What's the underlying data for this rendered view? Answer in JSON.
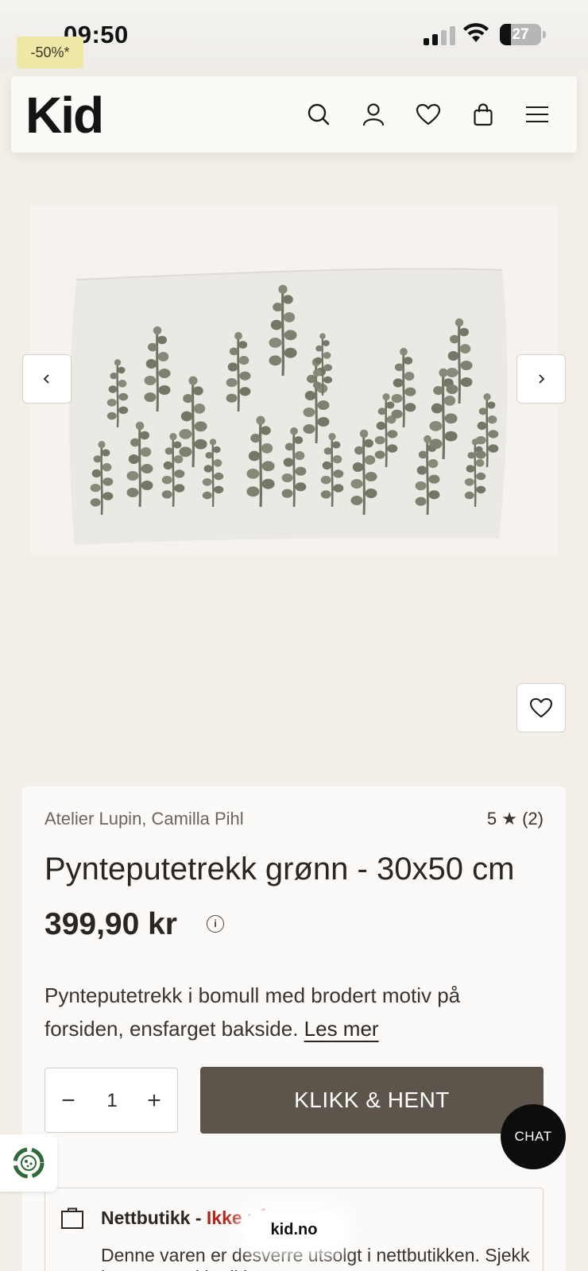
{
  "status_bar": {
    "time": "09:50",
    "battery": "27",
    "battery_level": 0.27
  },
  "promo_badge": "-50%*",
  "header": {
    "logo": "Kid",
    "icons": [
      "search-icon",
      "user-icon",
      "heart-icon",
      "bag-icon",
      "menu-icon"
    ]
  },
  "gallery": {
    "prev_icon": "chevron-left-icon",
    "next_icon": "chevron-right-icon",
    "favorite_icon": "heart-icon"
  },
  "product": {
    "brand": "Atelier Lupin, Camilla Pihl",
    "rating": "5 ★ (2)",
    "title": "Pynteputetrekk grønn - 30x50 cm",
    "price": "399,90 kr",
    "info_icon": "i",
    "description": "Pynteputetrekk i bomull med brodert motiv på forsiden, ensfarget bakside.",
    "read_more": "Les mer"
  },
  "quantity": {
    "minus": "−",
    "value": "1",
    "plus": "+"
  },
  "cta_label": "KLIKK & HENT",
  "stock": {
    "title": "Nettbutikk - ",
    "status": "Ikke på lager ✕",
    "text": "Denne varen er desverre utsolgt i nettbutikken. Sjekk lagerstatus i butikk."
  },
  "chat_label": "CHAT",
  "url": "kid.no",
  "colors": {
    "background": "#f3efe8",
    "cta": "#5d544b",
    "promo": "#efe7a6",
    "out_of_stock": "#b3261e"
  }
}
